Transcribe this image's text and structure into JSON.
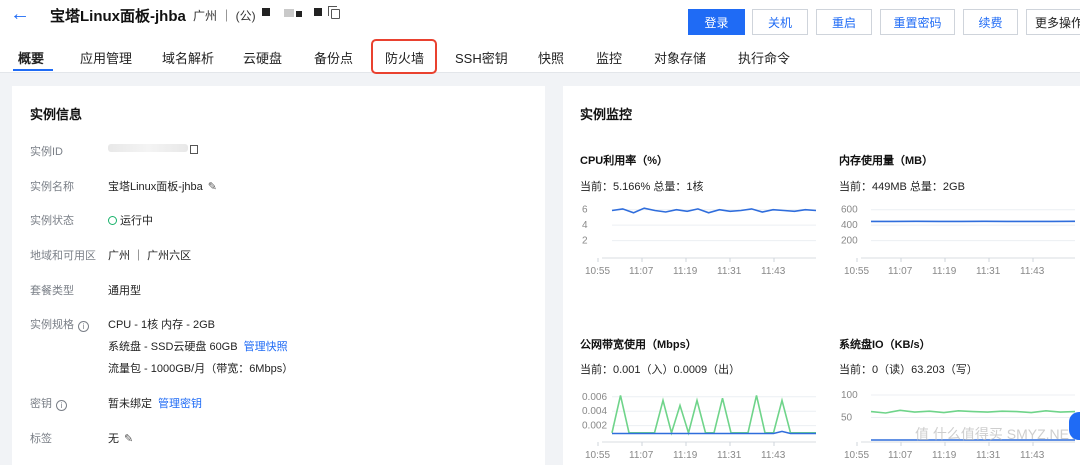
{
  "header": {
    "title": "宝塔Linux面板-jhba",
    "region": "广州 ｜ (公)",
    "buttons": {
      "login": "登录",
      "shutdown": "关机",
      "restart": "重启",
      "reset_password": "重置密码",
      "renew": "续费",
      "more": "更多操作"
    }
  },
  "tabs": [
    "概要",
    "应用管理",
    "域名解析",
    "云硬盘",
    "备份点",
    "防火墙",
    "SSH密钥",
    "快照",
    "监控",
    "对象存储",
    "执行命令"
  ],
  "instance": {
    "title": "实例信息",
    "rows": {
      "id_label": "实例ID",
      "name_label": "实例名称",
      "name_value": "宝塔Linux面板-jhba",
      "status_label": "实例状态",
      "status_value": "运行中",
      "region_label": "地域和可用区",
      "region_value": "广州 ｜ 广州六区",
      "package_label": "套餐类型",
      "package_value": "通用型",
      "spec_label": "实例规格",
      "spec_line1": "CPU - 1核 内存 - 2GB",
      "spec_line2": "系统盘 - SSD云硬盘 60GB",
      "spec_link": "管理快照",
      "spec_line3": "流量包 - 1000GB/月（带宽：6Mbps）",
      "key_label": "密钥",
      "key_value": "暂未绑定",
      "key_link": "管理密钥",
      "tag_label": "标签",
      "tag_value": "无"
    }
  },
  "monitor": {
    "title": "实例监控",
    "cpu": {
      "title": "CPU利用率（%）",
      "summary": "当前：5.166% 总量：1核"
    },
    "mem": {
      "title": "内存使用量（MB）",
      "summary": "当前：449MB 总量：2GB"
    },
    "net": {
      "title": "公网带宽使用（Mbps）",
      "summary": "当前：0.001（入）0.0009（出）"
    },
    "disk": {
      "title": "系统盘IO（KB/s）",
      "summary": "当前：0（读）63.203（写）"
    }
  },
  "chart_data": [
    {
      "type": "line",
      "name_key": "cpu",
      "x": [
        "10:55",
        "11:07",
        "11:19",
        "11:31",
        "11:43"
      ],
      "yticks": [
        6,
        4,
        2
      ],
      "ylim": [
        0,
        7
      ],
      "series": [
        {
          "values": [
            5.9,
            6.1,
            5.6,
            6.2,
            5.9,
            5.7,
            6.0,
            5.8,
            6.1,
            5.6,
            6.0,
            5.8,
            5.9,
            6.1,
            5.7,
            6.0,
            5.9,
            5.8,
            6.0,
            5.9
          ]
        }
      ],
      "color": "#2f6ddc"
    },
    {
      "type": "line",
      "name_key": "mem",
      "x": [
        "10:55",
        "11:07",
        "11:19",
        "11:31",
        "11:43"
      ],
      "yticks": [
        600,
        400,
        200
      ],
      "ylim": [
        0,
        700
      ],
      "series": [
        {
          "values": [
            449,
            449,
            450,
            449,
            449,
            450,
            449,
            449,
            449,
            450
          ]
        }
      ],
      "color": "#2f6ddc"
    },
    {
      "type": "line",
      "name_key": "net",
      "x": [
        "10:55",
        "11:07",
        "11:19",
        "11:31",
        "11:43"
      ],
      "yticks": [
        0.006,
        0.004,
        0.002
      ],
      "ylim": [
        0,
        0.0075
      ],
      "series": [
        {
          "values": [
            0.001,
            0.0062,
            0.001,
            0.001,
            0.001,
            0.001,
            0.0055,
            0.001,
            0.0048,
            0.001,
            0.0055,
            0.001,
            0.001,
            0.0058,
            0.001,
            0.001,
            0.001,
            0.0062,
            0.001,
            0.001,
            0.0055,
            0.001,
            0.001,
            0.001,
            0.001
          ],
          "color": "#6fd48a"
        },
        {
          "values": [
            0.0009,
            0.0009,
            0.0009,
            0.0009,
            0.0009,
            0.0009,
            0.0009,
            0.0009,
            0.0009,
            0.0009,
            0.0009,
            0.0009,
            0.0009,
            0.0009,
            0.0009,
            0.0009,
            0.0009,
            0.0009,
            0.0009,
            0.0009,
            0.0012,
            0.0009,
            0.0009,
            0.0009,
            0.0009
          ],
          "color": "#2f6ddc"
        }
      ]
    },
    {
      "type": "line",
      "name_key": "disk",
      "x": [
        "10:55",
        "11:07",
        "11:19",
        "11:31",
        "11:43"
      ],
      "yticks": [
        100,
        50
      ],
      "ylim": [
        0,
        120
      ],
      "series": [
        {
          "values": [
            63,
            60,
            66,
            62,
            64,
            61,
            65,
            63,
            62,
            64,
            63,
            61,
            65,
            62,
            63
          ],
          "color": "#6fd48a"
        },
        {
          "values": [
            0,
            0,
            0,
            0,
            0,
            0,
            0,
            0,
            0,
            0,
            0,
            0,
            0,
            0,
            0
          ],
          "color": "#2f6ddc"
        }
      ]
    }
  ],
  "watermark": "值 什么值得买 SMYZ.NET"
}
